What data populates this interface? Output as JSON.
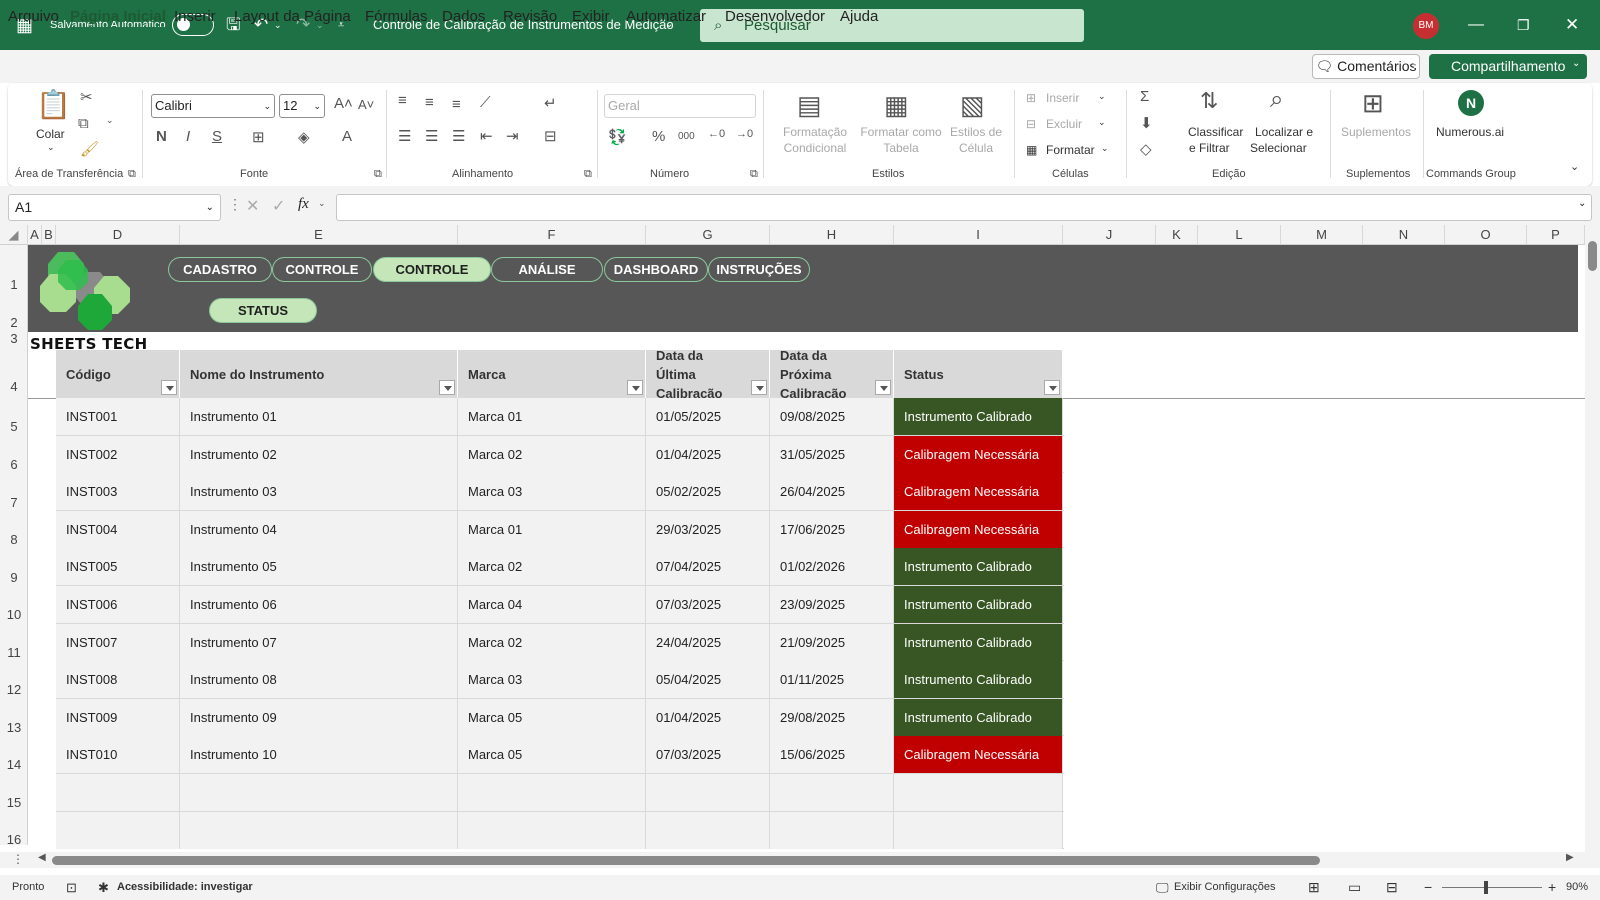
{
  "titlebar": {
    "autosave_label": "Salvamento Automático",
    "doc_title": "Controle de Calibração de Instrumentos de Medição",
    "search_placeholder": "Pesquisar",
    "avatar_initials": "BM"
  },
  "menu": [
    "Arquivo",
    "Página Inicial",
    "Inserir",
    "Layout da Página",
    "Fórmulas",
    "Dados",
    "Revisão",
    "Exibir",
    "Automatizar",
    "Desenvolvedor",
    "Ajuda"
  ],
  "menu_active": "Página Inicial",
  "actions": {
    "comments": "Comentários",
    "share": "Compartilhamento"
  },
  "ribbon": {
    "paste": "Colar",
    "clipboard_group": "Área de Transferência",
    "font_name": "Calibri",
    "font_size": "12",
    "font_group": "Fonte",
    "bold": "N",
    "italic": "I",
    "underline": "S",
    "alignment_group": "Alinhamento",
    "number_format": "Geral",
    "number_group": "Número",
    "conditional_format": [
      "Formatação",
      "Condicional"
    ],
    "format_as_table": [
      "Formatar como",
      "Tabela"
    ],
    "cell_styles": [
      "Estilos de",
      "Célula"
    ],
    "styles_group": "Estilos",
    "insert": "Inserir",
    "delete": "Excluir",
    "format": "Formatar",
    "cells_group": "Células",
    "sort_filter": [
      "Classificar",
      "e Filtrar"
    ],
    "find_select": [
      "Localizar e",
      "Selecionar"
    ],
    "editing_group": "Edição",
    "addins": "Suplementos",
    "addins_group": "Suplementos",
    "numerous": "Numerous.ai",
    "commands_group": "Commands Group"
  },
  "formula_bar": {
    "name_box": "A1",
    "fx": "fx",
    "formula": ""
  },
  "columns": [
    "A",
    "B",
    "D",
    "E",
    "F",
    "G",
    "H",
    "I",
    "J",
    "K",
    "L",
    "M",
    "N",
    "O",
    "P"
  ],
  "rows": [
    "1",
    "2",
    "3",
    "4",
    "5",
    "6",
    "7",
    "8",
    "9",
    "10",
    "11",
    "12",
    "13",
    "14",
    "15",
    "16"
  ],
  "dashboard_nav": [
    "CADASTRO",
    "CONTROLE",
    "CONTROLE",
    "ANÁLISE",
    "DASHBOARD",
    "INSTRUÇÕES"
  ],
  "dashboard_nav_active_index": 2,
  "status_button": "STATUS",
  "brand": "SHEETS TECH",
  "table": {
    "headers": [
      "Código",
      "Nome do Instrumento",
      "Marca",
      "Data da Última Calibração",
      "Data da Próxima Calibração",
      "Status"
    ],
    "rows": [
      [
        "INST001",
        "Instrumento 01",
        "Marca 01",
        "01/05/2025",
        "09/08/2025",
        "Instrumento Calibrado"
      ],
      [
        "INST002",
        "Instrumento 02",
        "Marca 02",
        "01/04/2025",
        "31/05/2025",
        "Calibragem Necessária"
      ],
      [
        "INST003",
        "Instrumento 03",
        "Marca 03",
        "05/02/2025",
        "26/04/2025",
        "Calibragem Necessária"
      ],
      [
        "INST004",
        "Instrumento 04",
        "Marca 01",
        "29/03/2025",
        "17/06/2025",
        "Calibragem Necessária"
      ],
      [
        "INST005",
        "Instrumento 05",
        "Marca 02",
        "07/04/2025",
        "01/02/2026",
        "Instrumento Calibrado"
      ],
      [
        "INST006",
        "Instrumento 06",
        "Marca 04",
        "07/03/2025",
        "23/09/2025",
        "Instrumento Calibrado"
      ],
      [
        "INST007",
        "Instrumento 07",
        "Marca 02",
        "24/04/2025",
        "21/09/2025",
        "Instrumento Calibrado"
      ],
      [
        "INST008",
        "Instrumento 08",
        "Marca 03",
        "05/04/2025",
        "01/11/2025",
        "Instrumento Calibrado"
      ],
      [
        "INST009",
        "Instrumento 09",
        "Marca 05",
        "01/04/2025",
        "29/08/2025",
        "Instrumento Calibrado"
      ],
      [
        "INST010",
        "Instrumento 10",
        "Marca 05",
        "07/03/2025",
        "15/06/2025",
        "Calibragem Necessária"
      ]
    ],
    "status_colors": {
      "Instrumento Calibrado": "#375623",
      "Calibragem Necessária": "#c00000"
    }
  },
  "statusbar": {
    "ready": "Pronto",
    "accessibility": "Acessibilidade: investigar",
    "display_settings": "Exibir Configurações",
    "zoom": "90%"
  },
  "colors": {
    "brand_green": "#1e7145",
    "band_gray": "#575757",
    "nav_active": "#c4e6b8"
  }
}
